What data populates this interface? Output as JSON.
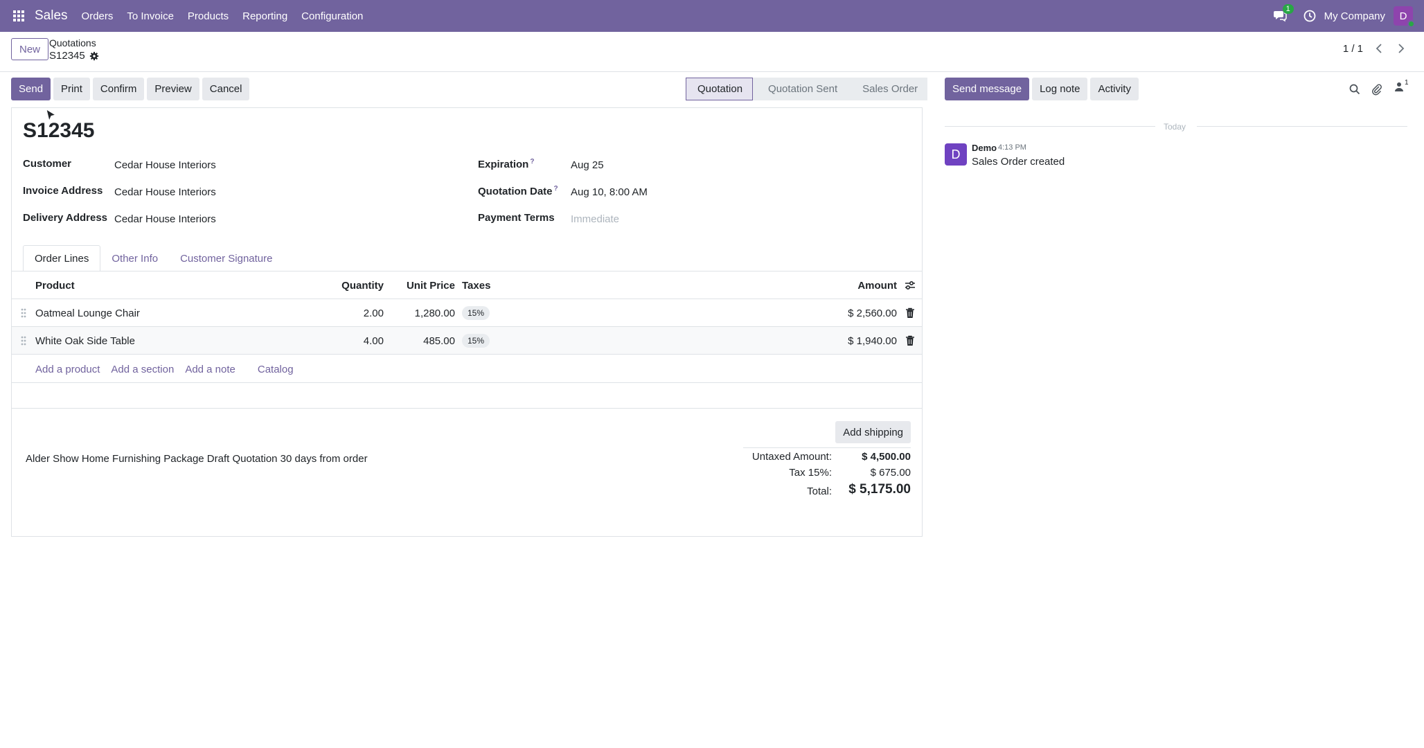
{
  "topnav": {
    "app_name": "Sales",
    "menu": [
      "Orders",
      "To Invoice",
      "Products",
      "Reporting",
      "Configuration"
    ],
    "chat_count": "1",
    "company": "My Company",
    "user_initial": "D"
  },
  "control": {
    "new_label": "New",
    "breadcrumb_parent": "Quotations",
    "breadcrumb_current": "S12345",
    "pager": "1 / 1"
  },
  "actions": {
    "send": "Send",
    "print": "Print",
    "confirm": "Confirm",
    "preview": "Preview",
    "cancel": "Cancel"
  },
  "status": {
    "stages": [
      "Quotation",
      "Quotation Sent",
      "Sales Order"
    ],
    "active_index": 0
  },
  "form": {
    "title": "S12345",
    "customer_label": "Customer",
    "customer_value": "Cedar House Interiors",
    "invoice_label": "Invoice Address",
    "invoice_value": "Cedar House Interiors",
    "delivery_label": "Delivery Address",
    "delivery_value": "Cedar House Interiors",
    "expiration_label": "Expiration",
    "expiration_value": "Aug 25",
    "qdate_label": "Quotation Date",
    "qdate_value": "Aug 10, 8:00 AM",
    "payment_label": "Payment Terms",
    "payment_placeholder": "Immediate",
    "help_mark": "?"
  },
  "tabs": [
    "Order Lines",
    "Other Info",
    "Customer Signature"
  ],
  "table": {
    "headers": {
      "product": "Product",
      "quantity": "Quantity",
      "unit_price": "Unit Price",
      "taxes": "Taxes",
      "amount": "Amount"
    },
    "rows": [
      {
        "product": "Oatmeal Lounge Chair",
        "quantity": "2.00",
        "unit_price": "1,280.00",
        "taxes": "15%",
        "amount": "$ 2,560.00"
      },
      {
        "product": "White Oak Side Table",
        "quantity": "4.00",
        "unit_price": "485.00",
        "taxes": "15%",
        "amount": "$ 1,940.00"
      }
    ],
    "add_product": "Add a product",
    "add_section": "Add a section",
    "add_note": "Add a note",
    "catalog": "Catalog"
  },
  "footer": {
    "add_shipping": "Add shipping",
    "note": "Alder Show Home Furnishing Package Draft Quotation 30 days from order",
    "untaxed_label": "Untaxed Amount:",
    "untaxed_value": "$ 4,500.00",
    "tax_label": "Tax 15%:",
    "tax_value": "$ 675.00",
    "total_label": "Total:",
    "total_value": "$ 5,175.00"
  },
  "chatter": {
    "send_message": "Send message",
    "log_note": "Log note",
    "activity": "Activity",
    "followers_count": "1",
    "today": "Today",
    "message": {
      "avatar": "D",
      "author": "Demo",
      "time": "4:13 PM",
      "body": "Sales Order created"
    }
  },
  "colors": {
    "brand": "#71639e",
    "badge": "#28a745"
  }
}
